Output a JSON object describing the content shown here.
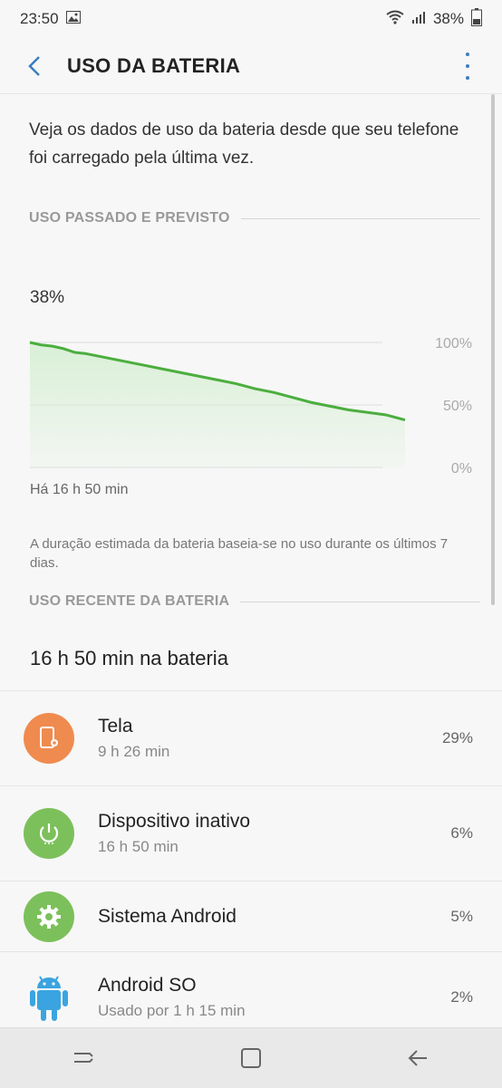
{
  "status": {
    "time": "23:50",
    "battery": "38%"
  },
  "appbar": {
    "title": "USO DA BATERIA"
  },
  "intro": "Veja os dados de uso da bateria desde que seu telefone foi carregado pela última vez.",
  "past_section": {
    "label": "USO PASSADO E PREVISTO"
  },
  "chart_data": {
    "type": "area",
    "current_label": "38%",
    "y_ticks": [
      "100%",
      "50%",
      "0%"
    ],
    "ylim": [
      0,
      100
    ],
    "x_label": "Há 16 h 50 min",
    "x": [
      0,
      0.03,
      0.06,
      0.09,
      0.12,
      0.15,
      0.2,
      0.25,
      0.3,
      0.35,
      0.4,
      0.45,
      0.5,
      0.55,
      0.6,
      0.65,
      0.7,
      0.75,
      0.8,
      0.85,
      0.9,
      0.95,
      1.0
    ],
    "values": [
      100,
      98,
      97,
      95,
      92,
      91,
      88,
      85,
      82,
      79,
      76,
      73,
      70,
      67,
      63,
      60,
      56,
      52,
      49,
      46,
      44,
      42,
      38
    ],
    "line_color": "#4cae3f",
    "fill_color": "#d9f0d6"
  },
  "note": "A duração estimada da bateria baseia-se no uso durante os últimos 7 dias.",
  "recent_section": {
    "label": "USO RECENTE DA BATERIA"
  },
  "total": "16 h 50 min na bateria",
  "items": [
    {
      "name": "Tela",
      "sub": "9 h 26 min",
      "pct": "29%",
      "color": "#ef8b4f",
      "icon": "screen-icon"
    },
    {
      "name": "Dispositivo inativo",
      "sub": "16 h 50 min",
      "pct": "6%",
      "color": "#7cc05b",
      "icon": "power-icon"
    },
    {
      "name": "Sistema Android",
      "sub": "",
      "pct": "5%",
      "color": "#7cc05b",
      "icon": "gear-icon"
    },
    {
      "name": "Android SO",
      "sub": "Usado por 1 h 15 min",
      "pct": "2%",
      "color": "#3aa4e0",
      "icon": "android-icon"
    }
  ]
}
